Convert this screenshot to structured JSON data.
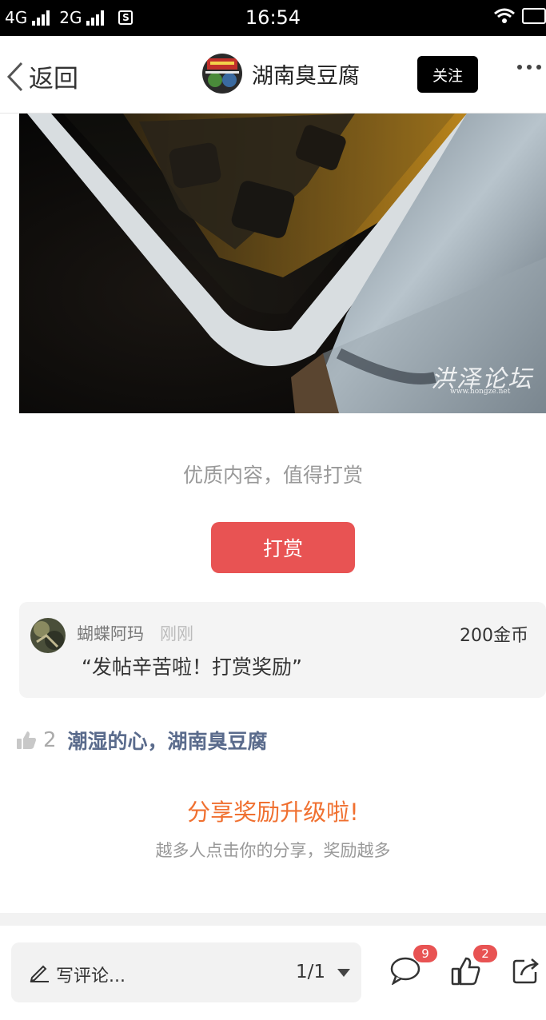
{
  "status_bar": {
    "network_1": "4G",
    "network_2": "2G",
    "sim_icon_letter": "S",
    "time": "16:54"
  },
  "nav": {
    "back_label": "返回",
    "title": "湖南臭豆腐",
    "follow_label": "关注"
  },
  "photo": {
    "watermark_main": "洪泽论坛",
    "watermark_url": "www.hongze.net"
  },
  "reward": {
    "prompt": "优质内容，值得打赏",
    "button_label": "打赏"
  },
  "reward_record": {
    "user_name": "蝴蝶阿玛",
    "time": "刚刚",
    "amount": "200金币",
    "message": "“发帖辛苦啦！打赏奖励”"
  },
  "likes": {
    "count": "2",
    "users": "潮湿的心，湖南臭豆腐"
  },
  "share": {
    "title": "分享奖励升级啦!",
    "subtitle": "越多人点击你的分享，奖励越多"
  },
  "bottom_bar": {
    "comment_placeholder": "写评论...",
    "page_indicator": "1/1",
    "comment_count": "9",
    "like_count": "2"
  },
  "colors": {
    "accent_red": "#e85353",
    "share_orange": "#f07030",
    "liker_blue": "#5a6b8c"
  }
}
